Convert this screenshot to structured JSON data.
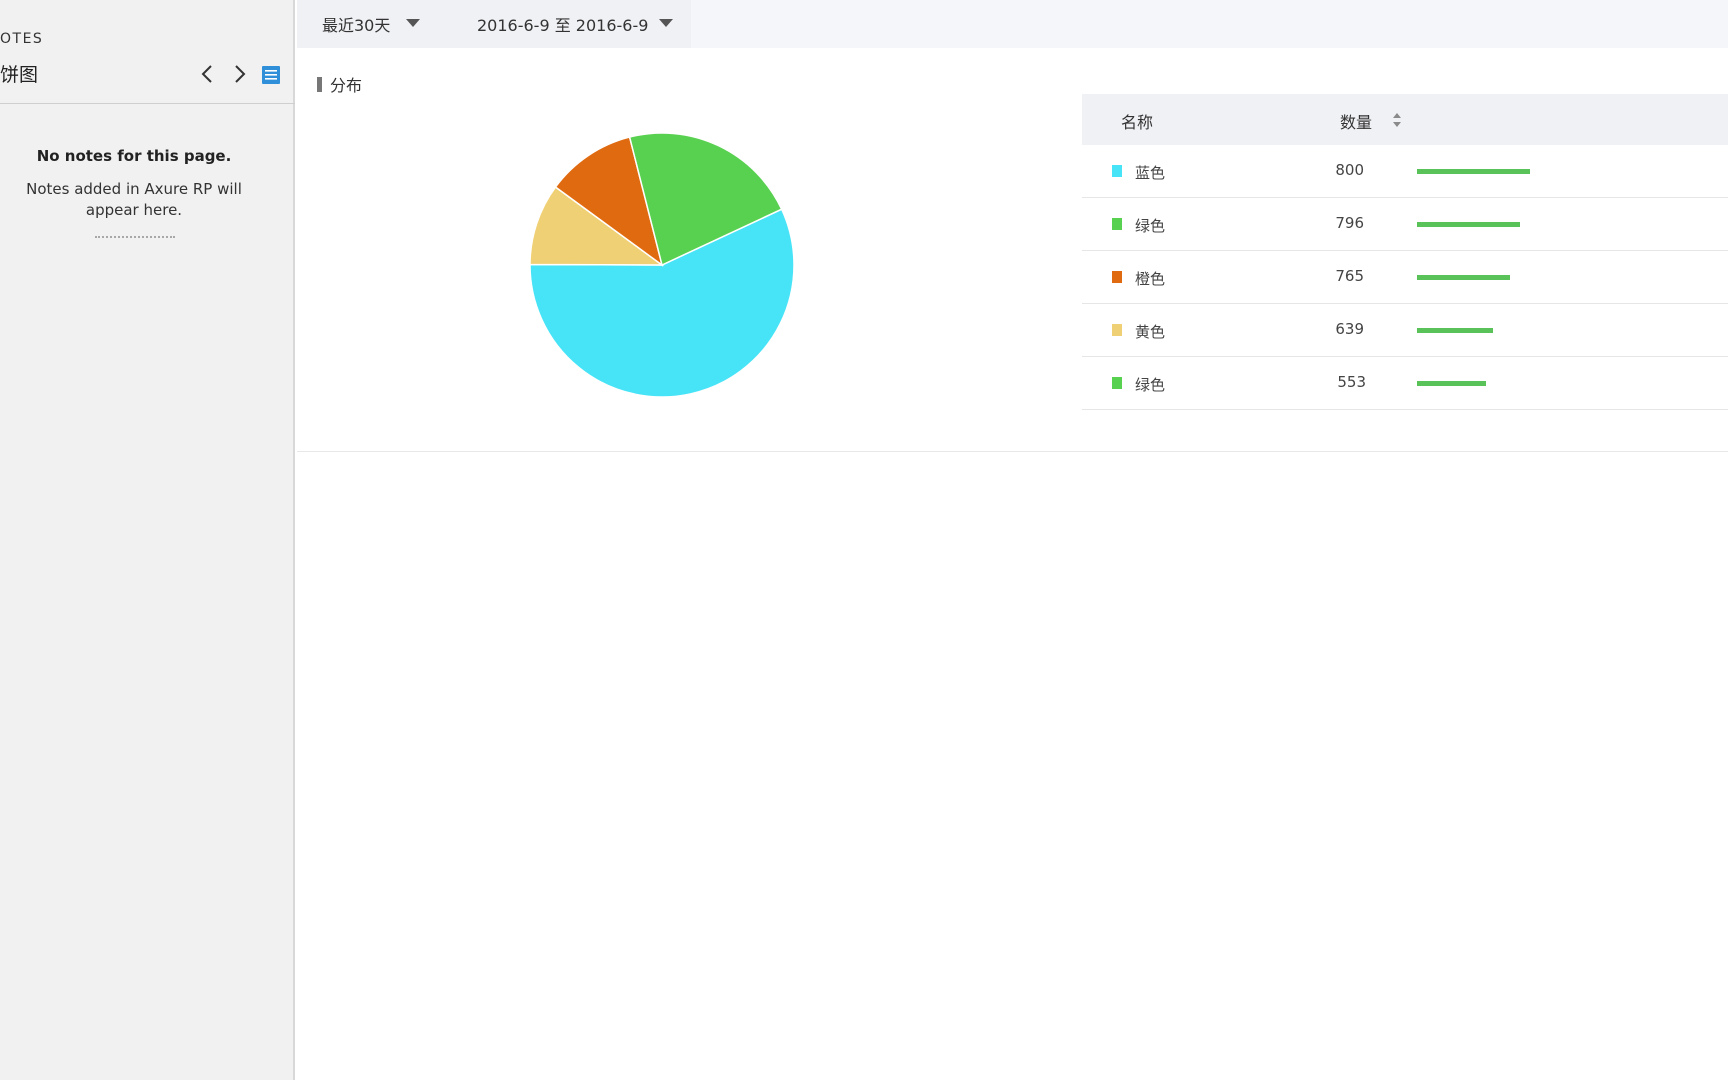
{
  "notes": {
    "header_title": "OTES",
    "page_name": "饼图",
    "empty_title": "No notes for this page.",
    "empty_desc": "Notes added in Axure RP will appear here."
  },
  "filters": {
    "range_label": "最近30天",
    "date_label": "2016-6-9 至 2016-6-9"
  },
  "section": {
    "title": "分布"
  },
  "table": {
    "col_name": "名称",
    "col_count": "数量",
    "rows": [
      {
        "name": "蓝色",
        "value": "800",
        "color": "#47e3f7",
        "bar_fraction": 1.0
      },
      {
        "name": "绿色",
        "value": "796",
        "color": "#59d150",
        "bar_fraction": 0.91
      },
      {
        "name": "橙色",
        "value": "765",
        "color": "#e06a10",
        "bar_fraction": 0.82
      },
      {
        "name": "黄色",
        "value": "639",
        "color": "#f0d074",
        "bar_fraction": 0.67
      },
      {
        "name": "绿色",
        "value": "553",
        "color": "#59d150",
        "bar_fraction": 0.61
      }
    ]
  },
  "chart_data": {
    "type": "pie",
    "slices": [
      {
        "label": "蓝色",
        "value": 57,
        "color": "#47e3f7"
      },
      {
        "label": "黄色",
        "value": 10,
        "color": "#f0d074"
      },
      {
        "label": "橙色",
        "value": 11,
        "color": "#e06a10"
      },
      {
        "label": "绿色",
        "value": 22,
        "color": "#59d150"
      }
    ]
  }
}
